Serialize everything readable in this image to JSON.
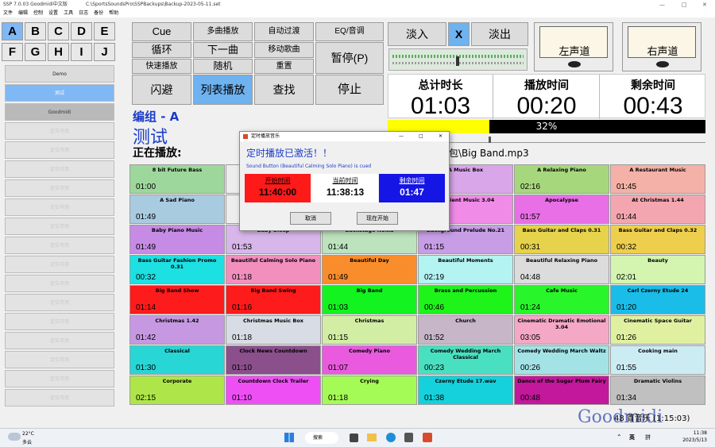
{
  "window": {
    "title": "SSP 7.0.03 Goodmidi中文版",
    "path": "C:\\SportsSoundsPro\\SSPBackups\\Backup-2023-05-11.set"
  },
  "menu": [
    "文件",
    "编辑",
    "控制",
    "设置",
    "工具",
    "日志",
    "备份",
    "帮助"
  ],
  "letters": [
    "A",
    "B",
    "C",
    "D",
    "E",
    "F",
    "G",
    "H",
    "I",
    "J"
  ],
  "groups": {
    "named": [
      "Demo",
      "测试",
      "Goodmidi"
    ],
    "empty_label": "定位可用"
  },
  "controls": {
    "cue": "Cue",
    "multi": "多曲播放",
    "autofade": "自动过渡",
    "eq": "EQ/音调",
    "loop": "循环",
    "next": "下一曲",
    "move": "移动歌曲",
    "pause": "暂停(P)",
    "quick": "快速播放",
    "random": "随机",
    "reset": "重置",
    "dodge": "闪避",
    "listplay": "列表播放",
    "find": "查找",
    "stop": "停止"
  },
  "fade": {
    "in": "淡入",
    "x": "X",
    "out": "淡出"
  },
  "meters": {
    "left": "左声道",
    "right": "右声道"
  },
  "time": {
    "total_label": "总计时长",
    "total": "01:03",
    "played_label": "播放时间",
    "played": "00:20",
    "remain_label": "剩余时间",
    "remain": "00:43"
  },
  "progress": {
    "fraction": 0.32,
    "text": "32%"
  },
  "group": {
    "title": "编组 - A",
    "name": "测试"
  },
  "now_playing": {
    "label": "正在播放:",
    "file_visible": "包\\Big Band.mp3"
  },
  "grid": [
    {
      "name": "8 bit Future Bass",
      "dur": "01:00",
      "color": "#9ed79c"
    },
    {
      "name": "",
      "dur": "",
      "color": "#ededed"
    },
    {
      "name": "",
      "dur": "",
      "color": "#ededed"
    },
    {
      "name": "A Music Box",
      "dur": "",
      "color": "#d9a6ea"
    },
    {
      "name": "A Relaxing Piano",
      "dur": "02:16",
      "color": "#a7d77d"
    },
    {
      "name": "A Restaurant Music",
      "dur": "01:45",
      "color": "#f4b1a7"
    },
    {
      "name": "A Sad Piano",
      "dur": "01:49",
      "color": "#a9cbe0"
    },
    {
      "name": "",
      "dur": "",
      "color": "#ededed"
    },
    {
      "name": "",
      "dur": "",
      "color": "#ededed"
    },
    {
      "name": "Ambient Music 3.04",
      "dur": "",
      "color": "#f08be8"
    },
    {
      "name": "Apocalypse",
      "dur": "01:57",
      "color": "#e86fe6"
    },
    {
      "name": "At Christmas 1.44",
      "dur": "01:44",
      "color": "#f4a6b0"
    },
    {
      "name": "Baby Piano Music",
      "dur": "01:49",
      "color": "#c68be5"
    },
    {
      "name": "Baby Sleep",
      "dur": "01:53",
      "color": "#d7b6ea"
    },
    {
      "name": "Backstage Nokia",
      "dur": "01:44",
      "color": "#bce3bd"
    },
    {
      "name": "Background Prelude No.21",
      "dur": "01:15",
      "color": "#c79ee6"
    },
    {
      "name": "Bass Guitar and Claps 0.31",
      "dur": "00:31",
      "color": "#e6d24b"
    },
    {
      "name": "Bass Guitar and Claps 0.32",
      "dur": "00:32",
      "color": "#eecf4d"
    },
    {
      "name": "Bass Guitar Fashion Promo 0.31",
      "dur": "00:32",
      "color": "#1de0e2"
    },
    {
      "name": "Beautiful Calming Solo Piano",
      "dur": "01:18",
      "color": "#f28fbd"
    },
    {
      "name": "Beautiful Day",
      "dur": "01:49",
      "color": "#fa8d2b"
    },
    {
      "name": "Beautiful Moments",
      "dur": "02:19",
      "color": "#b3f3f1"
    },
    {
      "name": "Beautiful Relaxing Piano",
      "dur": "04:48",
      "color": "#dcdcdc"
    },
    {
      "name": "Beauty",
      "dur": "02:01",
      "color": "#d3f5b0"
    },
    {
      "name": "Big Band Show",
      "dur": "01:14",
      "color": "#fe1b1b"
    },
    {
      "name": "Big Band Swing",
      "dur": "01:16",
      "color": "#fe1b1b"
    },
    {
      "name": "Big Band",
      "dur": "01:03",
      "color": "#12f31f"
    },
    {
      "name": "Brass and Percussion",
      "dur": "00:46",
      "color": "#1ef31a"
    },
    {
      "name": "Cafe Music",
      "dur": "01:24",
      "color": "#28f62a"
    },
    {
      "name": "Carl Czerny Etude 24",
      "dur": "01:20",
      "color": "#1abde7"
    },
    {
      "name": "Christmas 1.42",
      "dur": "01:42",
      "color": "#c798e2"
    },
    {
      "name": "Christmas Music Box",
      "dur": "01:18",
      "color": "#d7dce5"
    },
    {
      "name": "Christmas",
      "dur": "01:15",
      "color": "#d2eea4"
    },
    {
      "name": "Church",
      "dur": "01:52",
      "color": "#c6b6c8"
    },
    {
      "name": "Cinematic Dramatic Emotional 3.04",
      "dur": "03:05",
      "color": "#f5a8c6"
    },
    {
      "name": "Cinematic Space Guitar",
      "dur": "01:26",
      "color": "#dff1a1"
    },
    {
      "name": "Classical",
      "dur": "01:30",
      "color": "#28d6d6"
    },
    {
      "name": "Clock News Countdown",
      "dur": "01:10",
      "color": "#8b4f8c"
    },
    {
      "name": "Comedy Piano",
      "dur": "01:07",
      "color": "#e95ade"
    },
    {
      "name": "Comedy Wedding March Classical",
      "dur": "00:23",
      "color": "#49e0c1"
    },
    {
      "name": "Comedy Wedding March Waltz",
      "dur": "00:26",
      "color": "#a3e3e6"
    },
    {
      "name": "Cooking main",
      "dur": "01:55",
      "color": "#ccecf4"
    },
    {
      "name": "Corporate",
      "dur": "02:15",
      "color": "#aee649"
    },
    {
      "name": "Countdown Clock Trailer",
      "dur": "01:10",
      "color": "#ee4ff4"
    },
    {
      "name": "Crying",
      "dur": "01:18",
      "color": "#a5fb55"
    },
    {
      "name": "Czerny Etude 17.wav",
      "dur": "01:38",
      "color": "#14d1dc"
    },
    {
      "name": "Dance of the Sugar Plum Fairy",
      "dur": "00:48",
      "color": "#c3179c"
    },
    {
      "name": "Dramatic Violins",
      "dur": "01:34",
      "color": "#c0c0c0"
    }
  ],
  "footer": "48 首音乐 (1:15:03)",
  "watermark": "Goodmidi",
  "dialog": {
    "title": "定时播放音乐",
    "heading": "定时播放已激活！！",
    "sub": "Sound Button (Beautiful Calming Solo Piano) is cued",
    "start_label": "开始时间",
    "start": "11:40:00",
    "cur_label": "当前时间",
    "cur": "11:38:13",
    "rem_label": "剩余时间",
    "rem": "01:47",
    "cancel": "取消",
    "now": "现在开始"
  },
  "taskbar": {
    "weather_temp": "22°C",
    "weather_desc": "多云",
    "search": "搜索",
    "ime1": "英",
    "ime2": "拼",
    "time": "11:38",
    "date": "2023/5/13"
  }
}
